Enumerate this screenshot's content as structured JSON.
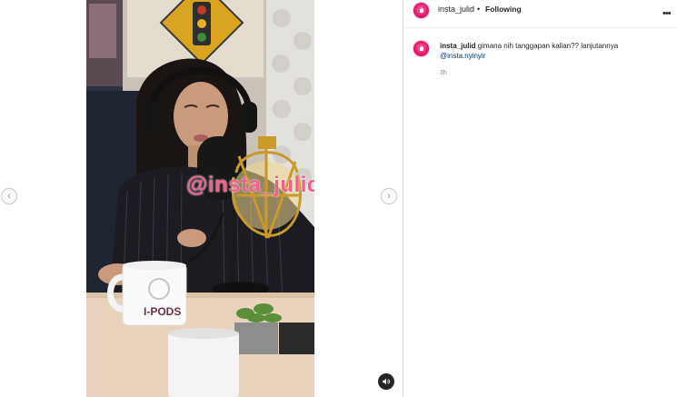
{
  "post": {
    "username": "insta_julid",
    "separator": "•",
    "follow_status": "Following",
    "more_icon": "more-horizontal-icon"
  },
  "caption": {
    "username": "insta_julid",
    "text": "gimana nih tanggapan kalian?? lanjutannya",
    "mention": "@insta.nyinyir",
    "time": "3h"
  },
  "media": {
    "watermark": "@insta_julid",
    "mug_brand": "I-PODS",
    "prev_icon": "chevron-left-icon",
    "next_icon": "chevron-right-icon",
    "audio_icon": "speaker-icon"
  },
  "colors": {
    "brand_pink": "#e8186d",
    "watermark_pink": "#f0608e",
    "text_primary": "#262626",
    "text_secondary": "#8e8e8e",
    "link": "#00376b"
  }
}
